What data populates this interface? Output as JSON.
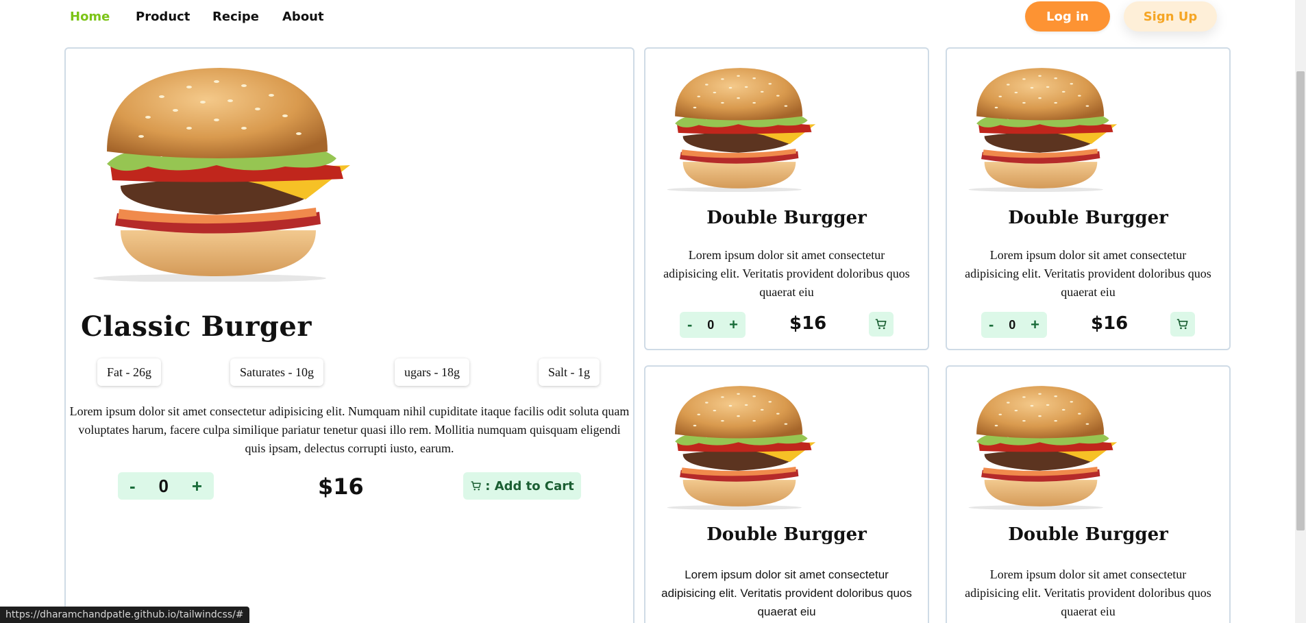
{
  "nav": {
    "links": [
      {
        "label": "Home"
      },
      {
        "label": "Product"
      },
      {
        "label": "Recipe"
      },
      {
        "label": "About"
      }
    ],
    "login_label": "Log in",
    "signup_label": "Sign Up"
  },
  "main_product": {
    "title": "Classic Burger",
    "nutrients": [
      "Fat - 26g",
      "Saturates - 10g",
      "ugars - 18g",
      "Salt - 1g"
    ],
    "description": "Lorem ipsum dolor sit amet consectetur adipisicing elit. Numquam nihil cupiditate itaque facilis odit soluta quam voluptates harum, facere culpa similique pariatur tenetur quasi illo rem. Mollitia numquam quisquam eligendi quis ipsam, delectus corrupti iusto, earum.",
    "qty_minus": "-",
    "qty_value": "0",
    "qty_plus": "+",
    "price": "$16",
    "add_to_cart_label": ": Add to Cart"
  },
  "cards": [
    {
      "title": "Double Burgger",
      "description": "Lorem ipsum dolor sit amet consectetur adipisicing elit. Veritatis provident doloribus quos quaerat eiu",
      "qty_minus": "-",
      "qty_value": "0",
      "qty_plus": "+",
      "price": "$16"
    },
    {
      "title": "Double Burgger",
      "description": "Lorem ipsum dolor sit amet consectetur adipisicing elit. Veritatis provident doloribus quos quaerat eiu",
      "qty_minus": "-",
      "qty_value": "0",
      "qty_plus": "+",
      "price": "$16"
    },
    {
      "title": "Double Burgger",
      "description": "Lorem ipsum dolor sit amet consectetur adipisicing elit. Veritatis provident doloribus quos quaerat eiu"
    },
    {
      "title": "Double Burgger",
      "description": "Lorem ipsum dolor sit amet consectetur adipisicing elit. Veritatis provident doloribus quos quaerat eiu"
    }
  ],
  "status_url": "https://dharamchandpatle.github.io/tailwindcss/#",
  "colors": {
    "accent_green": "#7cc417",
    "login_orange": "#fd9333",
    "signup_bg": "#feefd8",
    "signup_text": "#f5a524",
    "mint_bg": "#dcf8e8",
    "card_border": "#cfdbe6"
  }
}
